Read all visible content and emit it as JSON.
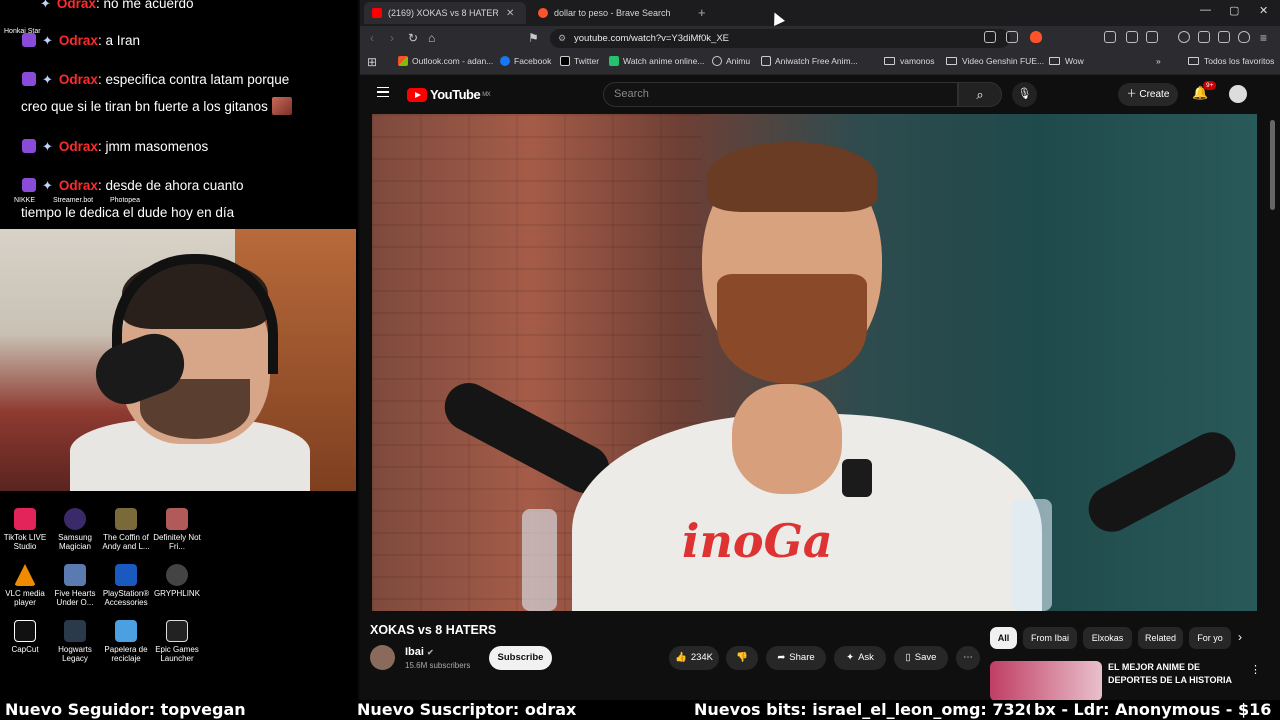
{
  "chat": {
    "line0": {
      "user": "Odrax",
      "text": ": no me acuerdo"
    },
    "line1": {
      "user": "Odrax",
      "text": ": a Iran"
    },
    "line2": {
      "user": "Odrax",
      "text": ": especifica contra latam porque",
      "cont": "creo que si le tiran bn fuerte a los gitanos"
    },
    "line3": {
      "user": "Odrax",
      "text": ": jmm masomenos"
    },
    "line4": {
      "user": "Odrax",
      "text": ": desde de ahora cuanto",
      "cont": "tiempo le dedica el dude hoy en día"
    }
  },
  "desktop": {
    "top_labels": [
      "Honkai Star",
      "NIKKE",
      "Streamer.bot",
      "Photopea"
    ],
    "icons": [
      {
        "label": "TikTok LIVE Studio",
        "color": "#e3245a"
      },
      {
        "label": "Samsung Magician",
        "color": "#3b2a6a"
      },
      {
        "label": "The Coffin of Andy and L...",
        "color": "#7a6a3a"
      },
      {
        "label": "Definitely Not Fri...",
        "color": "#b05a5a"
      },
      {
        "label": "VLC media player",
        "color": "#f08a00"
      },
      {
        "label": "Five Hearts Under O...",
        "color": "#5a7ab0"
      },
      {
        "label": "PlayStation® Accessories",
        "color": "#1a5ac0"
      },
      {
        "label": "GRYPHLINK",
        "color": "#444"
      },
      {
        "label": "CapCut",
        "color": "#111"
      },
      {
        "label": "Hogwarts Legacy",
        "color": "#2a3a4a"
      },
      {
        "label": "Papelera de reciclaje",
        "color": "#4aa0e0"
      },
      {
        "label": "Epic Games Launcher",
        "color": "#222"
      }
    ]
  },
  "browser": {
    "tabs": [
      {
        "label": "(2169) XOKAS vs 8 HATERS -",
        "color": "#ff0000"
      },
      {
        "label": "dollar to peso - Brave Search",
        "color": "#fb542b"
      }
    ],
    "url": "youtube.com/watch?v=Y3diMf0k_XE",
    "bookmarks": [
      "Outlook.com - adan...",
      "Facebook",
      "Twitter",
      "Watch anime online...",
      "Animu",
      "Aniwatch Free Anim...",
      "vamonos",
      "Video Genshin FUE...",
      "Wow",
      "Todos los favoritos"
    ]
  },
  "youtube": {
    "logo": "YouTube",
    "region": "MX",
    "search_placeholder": "Search",
    "create": "Create",
    "notif_count": "9+",
    "video_title": "XOKAS vs 8 HATERS",
    "channel": "Ibai",
    "subscribers": "15.6M subscribers",
    "subscribe": "Subscribe",
    "likes": "234K",
    "share": "Share",
    "ask": "Ask",
    "save": "Save",
    "chips": [
      "All",
      "From Ibai",
      "Elxokas",
      "Related",
      "For yo"
    ],
    "rec_title": "EL MEJOR ANIME DE DEPORTES DE LA HISTORIA",
    "shirt_text": "inoGa"
  },
  "ticker": {
    "follower": "Nuevo Seguidor: topvegan",
    "subscriber": "Nuevo Suscriptor: odrax",
    "bits": "Nuevos bits: israel_el_leon_omg: 7320",
    "donor": "bx - Ldr: Anonymous - $16"
  }
}
